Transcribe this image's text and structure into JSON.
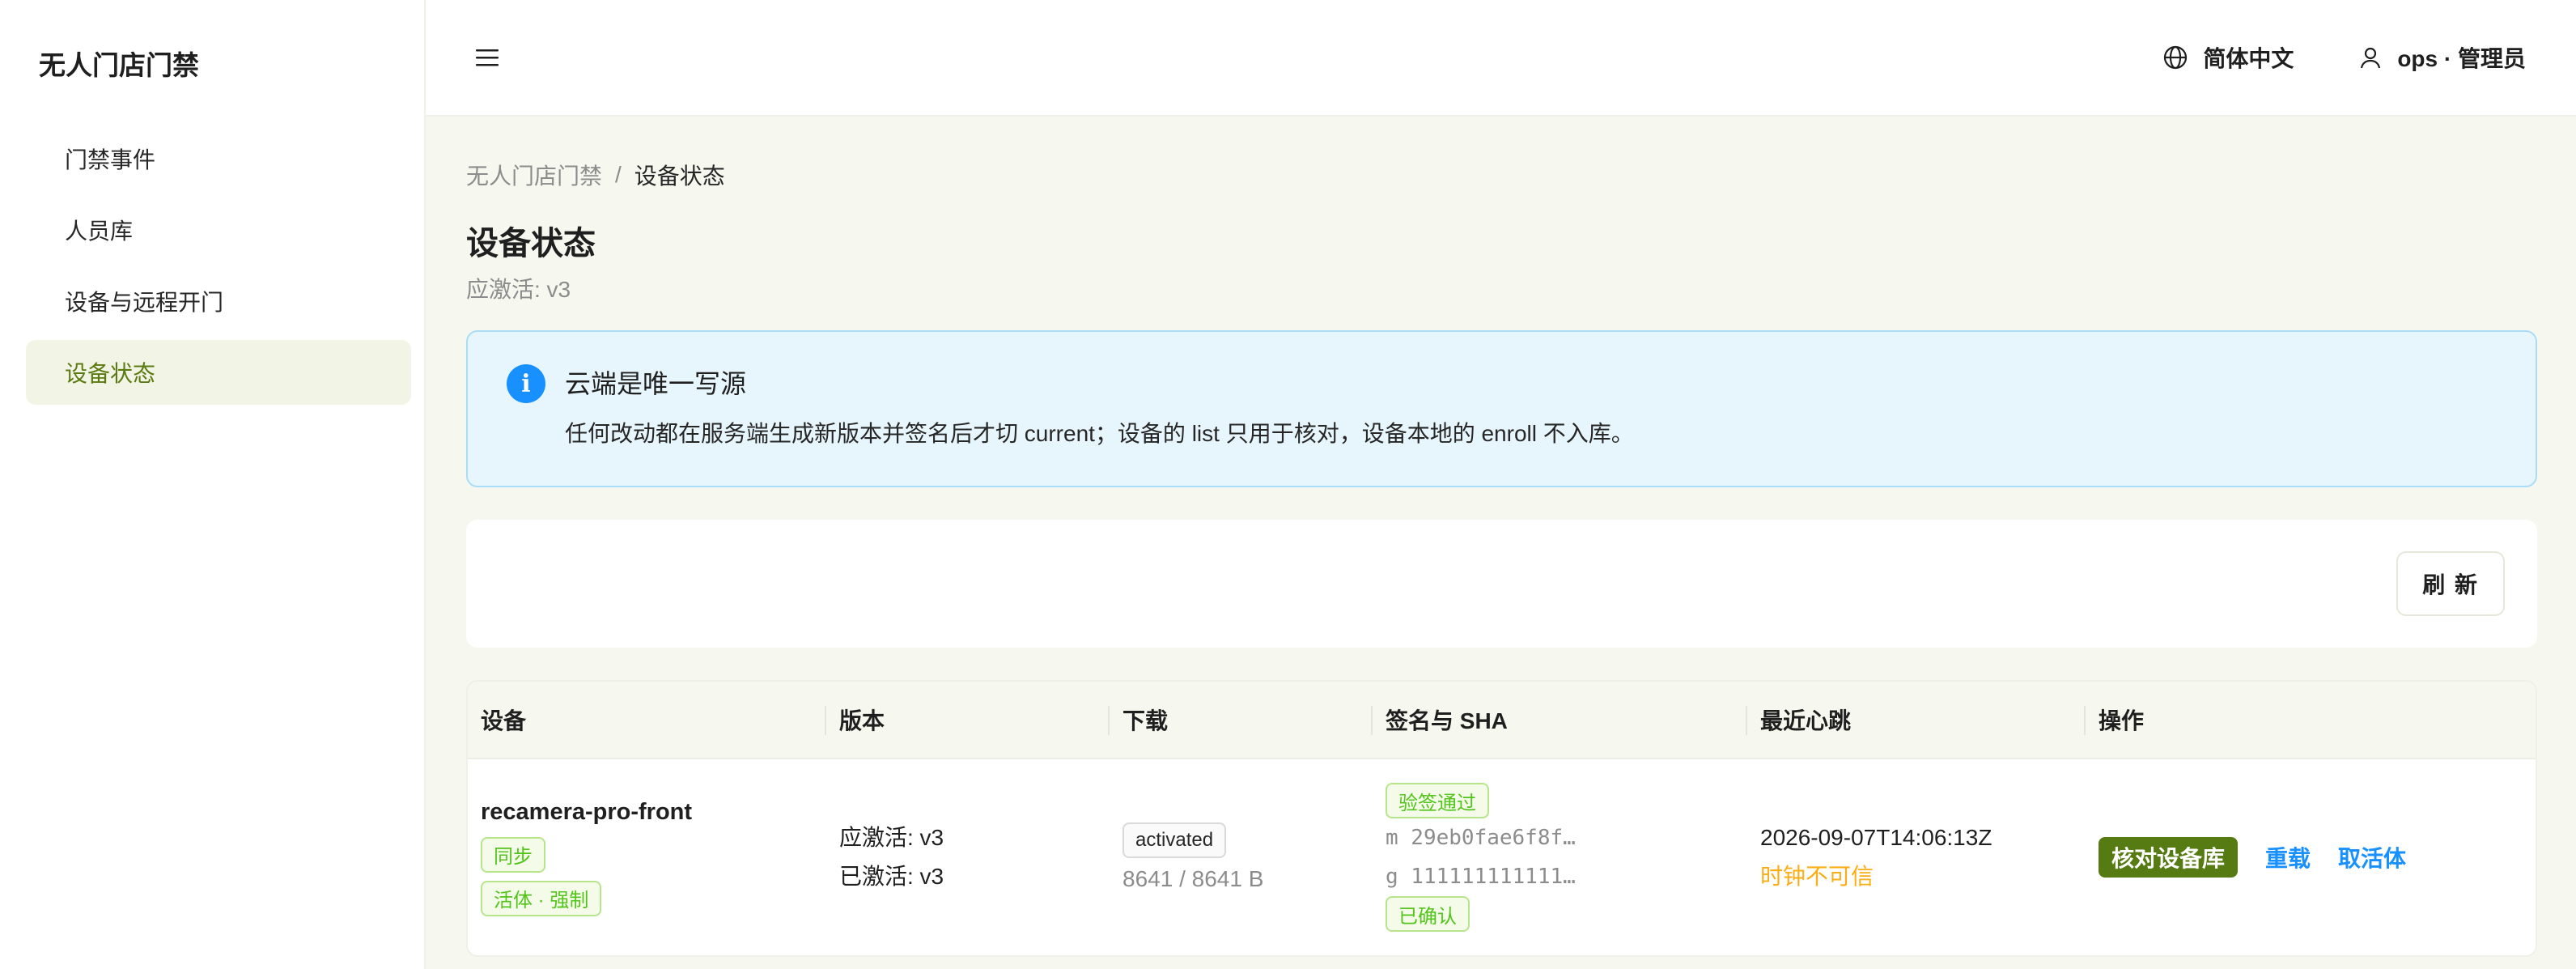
{
  "sidebar": {
    "brand": "无人门店门禁",
    "items": [
      {
        "label": "门禁事件"
      },
      {
        "label": "人员库"
      },
      {
        "label": "设备与远程开门"
      },
      {
        "label": "设备状态",
        "active": true
      }
    ]
  },
  "topbar": {
    "language": "简体中文",
    "user": "ops · 管理员"
  },
  "breadcrumb": {
    "root": "无人门店门禁",
    "separator": "/",
    "current": "设备状态"
  },
  "page": {
    "title": "设备状态",
    "subtitle": "应激活: v3"
  },
  "alert": {
    "title": "云端是唯一写源",
    "description": "任何改动都在服务端生成新版本并签名后才切 current；设备的 list 只用于核对，设备本地的 enroll 不入库。"
  },
  "toolbar": {
    "refresh_label": "刷 新"
  },
  "table": {
    "columns": [
      "设备",
      "版本",
      "下载",
      "签名与 SHA",
      "最近心跳",
      "操作"
    ],
    "rows": [
      {
        "device": "recamera-pro-front",
        "tags": [
          "同步",
          "活体 · 强制"
        ],
        "version_expected": "应激活: v3",
        "version_active": "已激活: v3",
        "download_status": "activated",
        "download_bytes": "8641 / 8641 B",
        "sig_tag": "验签通过",
        "sha_m": "m 29eb0fae6f8f…",
        "sha_g": "g 111111111111…",
        "confirm_tag": "已确认",
        "heartbeat": "2026-09-07T14:06:13Z",
        "clock_warning": "时钟不可信",
        "action_primary": "核对设备库",
        "action_reload": "重载",
        "action_cancel": "取活体"
      }
    ]
  },
  "colors": {
    "accent": "#567b12",
    "link": "#1890ff",
    "success": "#52c41a",
    "warning": "#faad14",
    "info_bg": "#e7f6fd"
  }
}
